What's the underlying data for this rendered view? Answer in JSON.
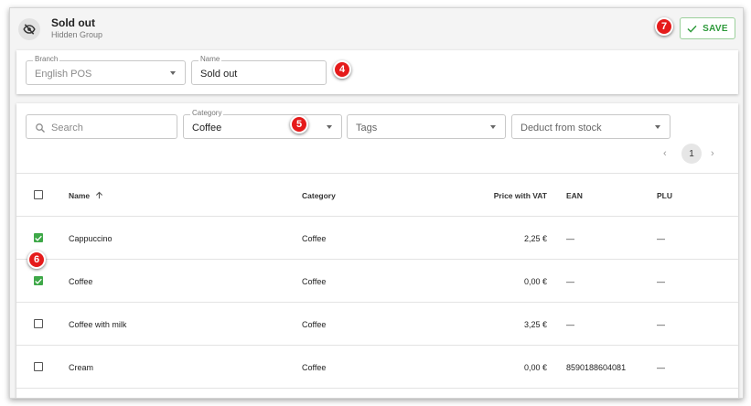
{
  "header": {
    "title": "Sold out",
    "subtitle": "Hidden Group",
    "save_label": "SAVE"
  },
  "form": {
    "branch_label": "Branch",
    "branch_value": "English POS",
    "name_label": "Name",
    "name_value": "Sold out"
  },
  "filters": {
    "search_placeholder": "Search",
    "category_label": "Category",
    "category_value": "Coffee",
    "tags_placeholder": "Tags",
    "deduct_placeholder": "Deduct from stock"
  },
  "pagination": {
    "current_page": "1"
  },
  "table": {
    "columns": {
      "name": "Name",
      "category": "Category",
      "price": "Price with VAT",
      "ean": "EAN",
      "plu": "PLU"
    },
    "rows": [
      {
        "checked": true,
        "name": "Cappuccino",
        "category": "Coffee",
        "price": "2,25 €",
        "ean": "—",
        "plu": "—"
      },
      {
        "checked": true,
        "name": "Coffee",
        "category": "Coffee",
        "price": "0,00 €",
        "ean": "—",
        "plu": "—"
      },
      {
        "checked": false,
        "name": "Coffee with milk",
        "category": "Coffee",
        "price": "3,25 €",
        "ean": "—",
        "plu": "—"
      },
      {
        "checked": false,
        "name": "Cream",
        "category": "Coffee",
        "price": "0,00 €",
        "ean": "8590188604081",
        "plu": "—"
      }
    ]
  },
  "markers": {
    "m4": "4",
    "m5": "5",
    "m6": "6",
    "m7": "7"
  },
  "colors": {
    "accent_green": "#3ea848",
    "marker_red": "#e51b1b"
  },
  "icons": [
    "eye-off-icon",
    "check-icon",
    "search-icon",
    "chevron-down-icon",
    "chevron-left-icon",
    "chevron-right-icon",
    "arrow-up-icon"
  ]
}
